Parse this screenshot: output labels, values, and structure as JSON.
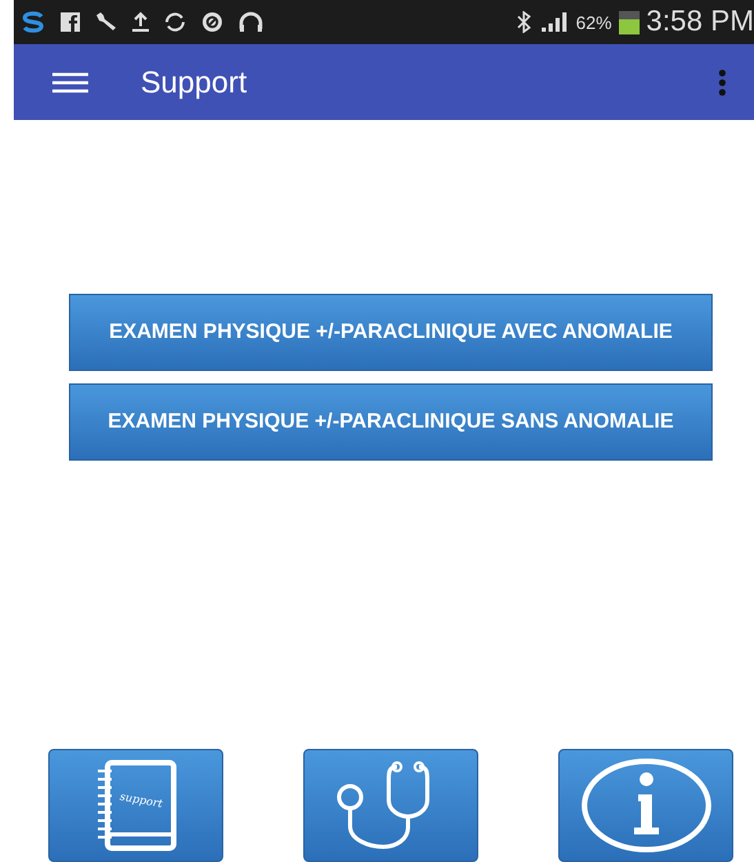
{
  "status_bar": {
    "battery_text": "62%",
    "battery": {
      "level": 0.62
    },
    "time": "3:58 PM"
  },
  "app_bar": {
    "title": "Support"
  },
  "buttons": [
    {
      "label": "EXAMEN PHYSIQUE +/-PARACLINIQUE AVEC ANOMALIE"
    },
    {
      "label": "EXAMEN PHYSIQUE +/-PARACLINIQUE SANS ANOMALIE"
    }
  ],
  "bottom_buttons": [
    {
      "kind": "notebook",
      "label": "support"
    },
    {
      "kind": "stethoscope"
    },
    {
      "kind": "info"
    }
  ]
}
